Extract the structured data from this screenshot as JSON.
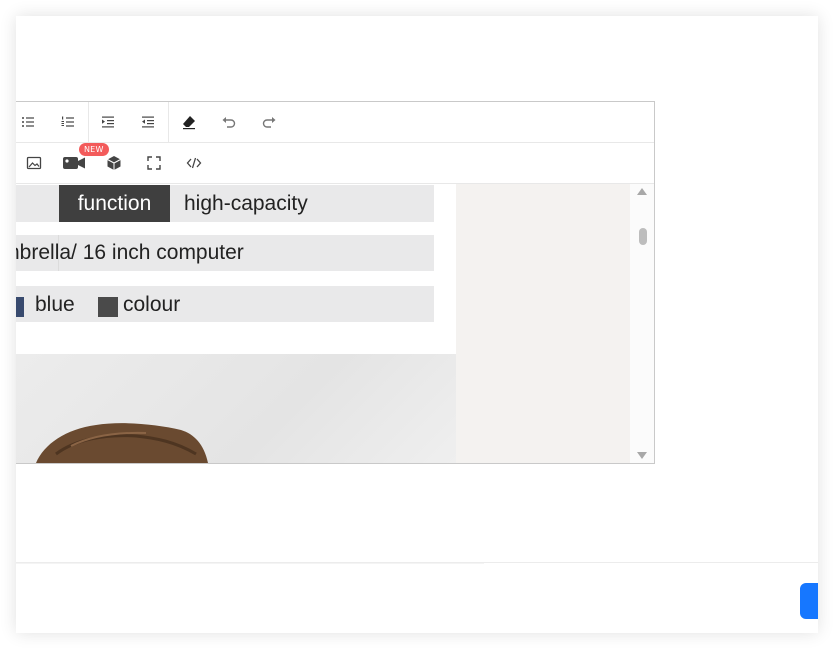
{
  "toolbar": {
    "row1": [
      {
        "name": "bulleted-list-icon"
      },
      {
        "name": "numbered-list-icon"
      },
      {
        "name": "indent-icon"
      },
      {
        "name": "outdent-icon"
      },
      {
        "name": "eraser-icon"
      },
      {
        "name": "undo-icon"
      },
      {
        "name": "redo-icon"
      }
    ],
    "row2": [
      {
        "name": "image-icon"
      },
      {
        "name": "video-icon"
      },
      {
        "name": "3d-model-icon"
      },
      {
        "name": "fullscreen-icon"
      },
      {
        "name": "code-icon"
      }
    ],
    "new_badge": "NEW"
  },
  "content": {
    "spec1": {
      "label": "function",
      "value": "high-capacity"
    },
    "spec2": {
      "value": "nbrella/ 16 inch computer"
    },
    "spec3": {
      "color1": "blue",
      "color2": "colour"
    }
  },
  "colors": {
    "accent": "#1677ff",
    "badge": "#f35b5b",
    "label_bg": "#3f3f3f",
    "row_bg": "#e9e9ea",
    "swatch_blue": "#384a6e",
    "swatch_dark": "#4a4a4a"
  },
  "footer": {
    "primary_button_label": ""
  }
}
